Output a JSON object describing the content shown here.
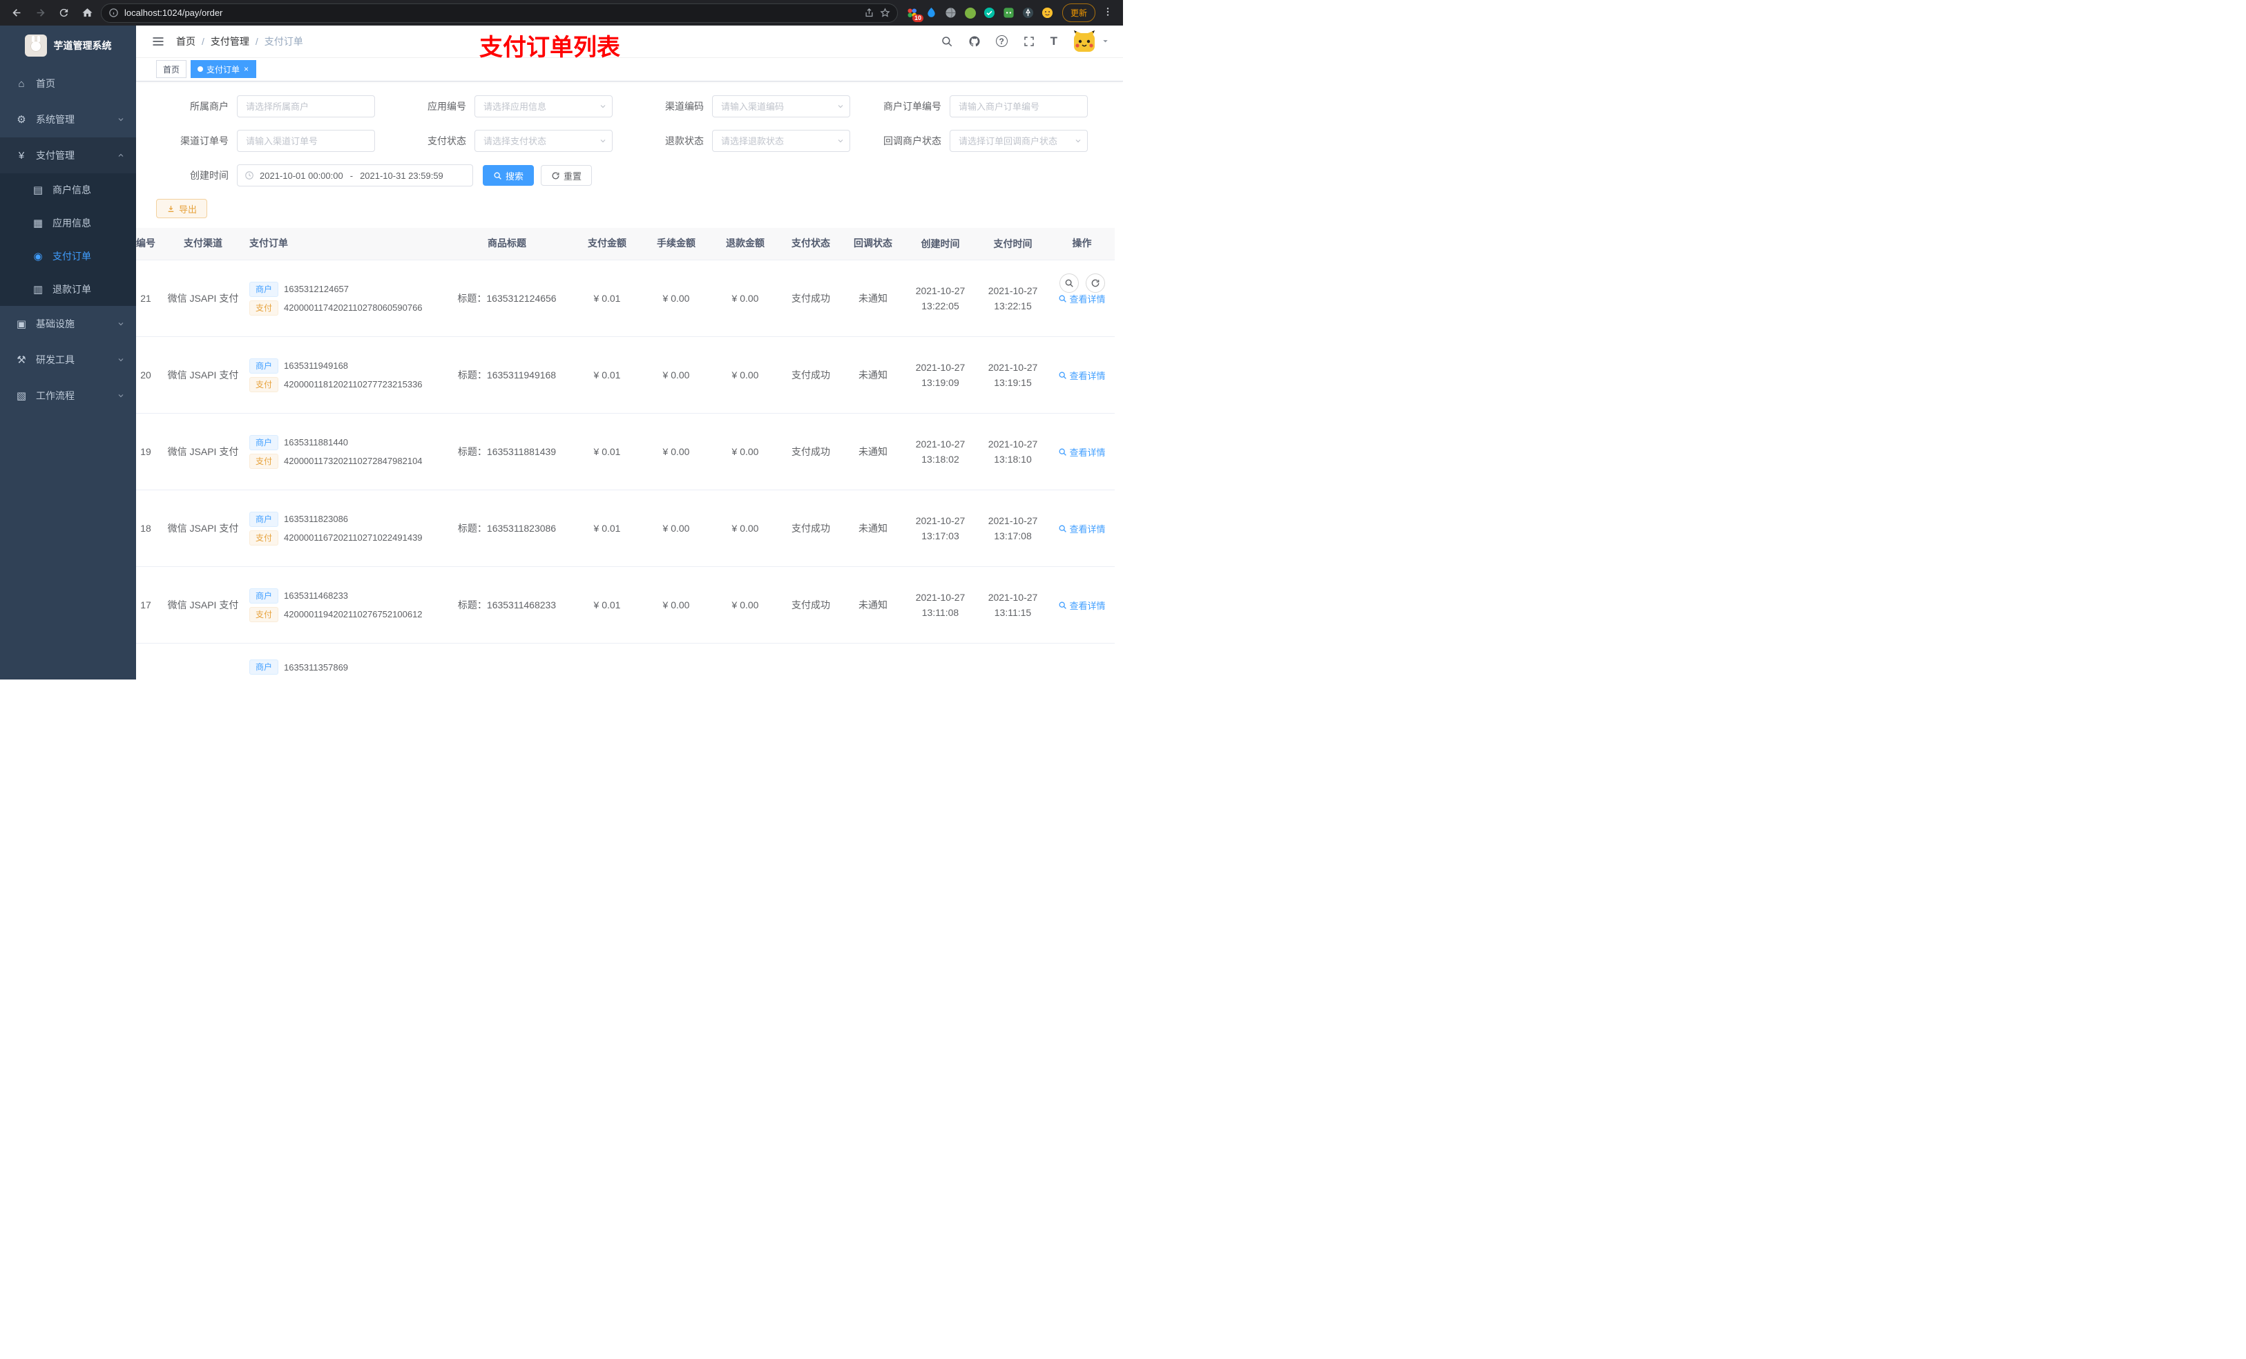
{
  "browser": {
    "url": "localhost:1024/pay/order",
    "update_label": "更新",
    "extension_badge": "10"
  },
  "sidebar": {
    "logo_title": "芋道管理系统",
    "menu_home": "首页",
    "menu_system": "系统管理",
    "menu_pay": "支付管理",
    "sub_merchant": "商户信息",
    "sub_app": "应用信息",
    "sub_pay_order": "支付订单",
    "sub_refund_order": "退款订单",
    "menu_infra": "基础设施",
    "menu_devtool": "研发工具",
    "menu_workflow": "工作流程"
  },
  "header": {
    "breadcrumb": [
      "首页",
      "支付管理",
      "支付订单"
    ],
    "annotation": "支付订单列表"
  },
  "tags": {
    "home": "首页",
    "current": "支付订单"
  },
  "filters": {
    "items": [
      {
        "label": "所属商户",
        "placeholder": "请选择所属商户"
      },
      {
        "label": "应用编号",
        "placeholder": "请选择应用信息"
      },
      {
        "label": "渠道编码",
        "placeholder": "请输入渠道编码"
      },
      {
        "label": "商户订单编号",
        "placeholder": "请输入商户订单编号"
      },
      {
        "label": "渠道订单号",
        "placeholder": "请输入渠道订单号"
      },
      {
        "label": "支付状态",
        "placeholder": "请选择支付状态"
      },
      {
        "label": "退款状态",
        "placeholder": "请选择退款状态"
      },
      {
        "label": "回调商户状态",
        "placeholder": "请选择订单回调商户状态"
      }
    ],
    "date_label": "创建时间",
    "date_start": "2021-10-01 00:00:00",
    "date_separator": "-",
    "date_end": "2021-10-31 23:59:59",
    "search_label": "搜索",
    "reset_label": "重置"
  },
  "toolbar": {
    "export_label": "导出"
  },
  "table": {
    "columns": [
      "编号",
      "支付渠道",
      "支付订单",
      "商品标题",
      "支付金额",
      "手续金额",
      "退款金额",
      "支付状态",
      "回调状态",
      "创建时间",
      "支付时间",
      "操作"
    ],
    "badges": {
      "merchant": "商户",
      "pay": "支付"
    },
    "rows": [
      {
        "id": "21",
        "channel": "微信 JSAPI 支付",
        "merchant_no": "1635312124657",
        "pay_no": "4200001174202110278060590766",
        "title": "标题：1635312124656",
        "amount": "¥ 0.01",
        "fee": "¥ 0.00",
        "refund": "¥ 0.00",
        "status": "支付成功",
        "notify": "未通知",
        "create_date": "2021-10-27",
        "create_time": "13:22:05",
        "pay_date": "2021-10-27",
        "pay_time": "13:22:15",
        "action": "查看详情"
      },
      {
        "id": "20",
        "channel": "微信 JSAPI 支付",
        "merchant_no": "1635311949168",
        "pay_no": "4200001181202110277723215336",
        "title": "标题：1635311949168",
        "amount": "¥ 0.01",
        "fee": "¥ 0.00",
        "refund": "¥ 0.00",
        "status": "支付成功",
        "notify": "未通知",
        "create_date": "2021-10-27",
        "create_time": "13:19:09",
        "pay_date": "2021-10-27",
        "pay_time": "13:19:15",
        "action": "查看详情"
      },
      {
        "id": "19",
        "channel": "微信 JSAPI 支付",
        "merchant_no": "1635311881440",
        "pay_no": "4200001173202110272847982104",
        "title": "标题：1635311881439",
        "amount": "¥ 0.01",
        "fee": "¥ 0.00",
        "refund": "¥ 0.00",
        "status": "支付成功",
        "notify": "未通知",
        "create_date": "2021-10-27",
        "create_time": "13:18:02",
        "pay_date": "2021-10-27",
        "pay_time": "13:18:10",
        "action": "查看详情"
      },
      {
        "id": "18",
        "channel": "微信 JSAPI 支付",
        "merchant_no": "1635311823086",
        "pay_no": "4200001167202110271022491439",
        "title": "标题：1635311823086",
        "amount": "¥ 0.01",
        "fee": "¥ 0.00",
        "refund": "¥ 0.00",
        "status": "支付成功",
        "notify": "未通知",
        "create_date": "2021-10-27",
        "create_time": "13:17:03",
        "pay_date": "2021-10-27",
        "pay_time": "13:17:08",
        "action": "查看详情"
      },
      {
        "id": "17",
        "channel": "微信 JSAPI 支付",
        "merchant_no": "1635311468233",
        "pay_no": "4200001194202110276752100612",
        "title": "标题：1635311468233",
        "amount": "¥ 0.01",
        "fee": "¥ 0.00",
        "refund": "¥ 0.00",
        "status": "支付成功",
        "notify": "未通知",
        "create_date": "2021-10-27",
        "create_time": "13:11:08",
        "pay_date": "2021-10-27",
        "pay_time": "13:11:15",
        "action": "查看详情"
      }
    ],
    "partial_row": {
      "merchant_no": "1635311357869"
    }
  }
}
